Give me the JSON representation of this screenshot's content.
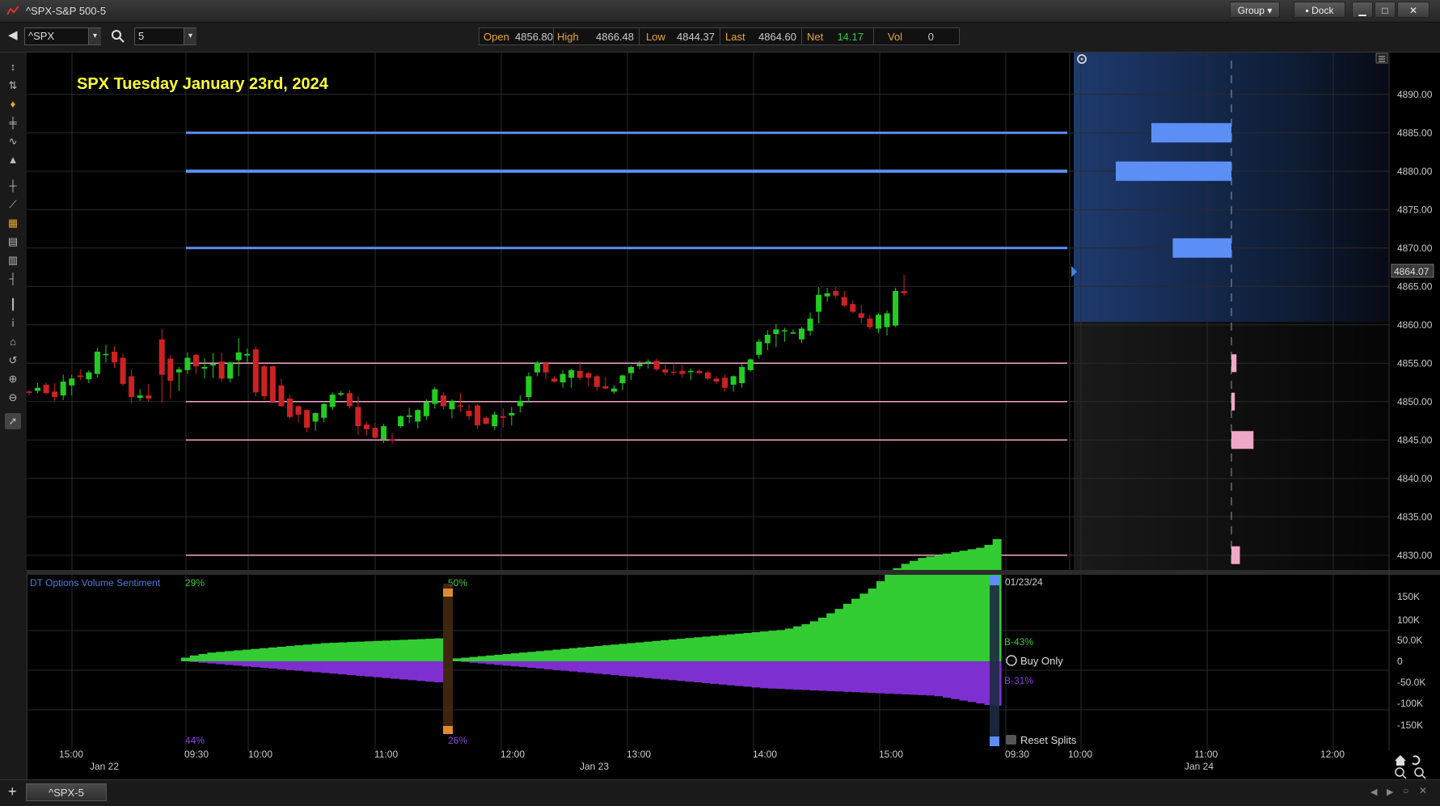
{
  "window": {
    "title": "^SPX-S&P 500-5",
    "group_label": "Group",
    "dock_label": "Dock"
  },
  "toolbar": {
    "symbol": "^SPX",
    "interval": "5"
  },
  "quote": {
    "open_label": "Open",
    "open": "4856.80",
    "high_label": "High",
    "high": "4866.48",
    "low_label": "Low",
    "low": "4844.37",
    "last_label": "Last",
    "last": "4864.60",
    "net_label": "Net",
    "net": "14.17",
    "vol_label": "Vol",
    "vol": "0"
  },
  "chart_title": "SPX Tuesday January 23rd, 2024",
  "colors": {
    "title": "#ffff33",
    "up": "#22cc22",
    "down": "#cc2222",
    "resistance": "#5b8ff5",
    "support": "#f0a8c8",
    "bull_vol": "#33cc33",
    "bear_vol": "#7e2fd0"
  },
  "price_axis": {
    "ticks": [
      "4890.00",
      "4885.00",
      "4880.00",
      "4875.00",
      "4870.00",
      "4865.00",
      "4860.00",
      "4855.00",
      "4850.00",
      "4845.00",
      "4840.00",
      "4835.00",
      "4830.00"
    ],
    "current": "4864.07"
  },
  "time_axis": {
    "times": [
      "15:00",
      "09:30",
      "10:00",
      "11:00",
      "12:00",
      "13:00",
      "14:00",
      "15:00",
      "09:30",
      "10:00",
      "11:00",
      "12:00"
    ],
    "dates": [
      "Jan 22",
      "Jan 23",
      "Jan 24"
    ]
  },
  "levels": {
    "resistance": [
      4885,
      4880,
      4870
    ],
    "support": [
      4855,
      4850,
      4845,
      4830
    ]
  },
  "profile": {
    "blue_bars": [
      {
        "price": 4885,
        "size": 0.45
      },
      {
        "price": 4880,
        "size": 0.65
      },
      {
        "price": 4870,
        "size": 0.33
      }
    ],
    "pink_bars": [
      {
        "price": 4855,
        "size": 0.03
      },
      {
        "price": 4850,
        "size": 0.02
      },
      {
        "price": 4845,
        "size": 0.13
      },
      {
        "price": 4830,
        "size": 0.05
      }
    ]
  },
  "chart_data": {
    "type": "candlestick",
    "title": "SPX Tuesday January 23rd, 2024",
    "ylim": [
      4826,
      4892
    ],
    "candles": [
      [
        4851.3,
        4851.5,
        4850.8,
        4851.2
      ],
      [
        4851.4,
        4852.4,
        4851.1,
        4851.8
      ],
      [
        4852.2,
        4852.5,
        4850.9,
        4851.1
      ],
      [
        4851.3,
        4852.4,
        4850.1,
        4850.6
      ],
      [
        4850.8,
        4853.5,
        4850.2,
        4852.6
      ],
      [
        4852.1,
        4853.5,
        4850.8,
        4853.0
      ],
      [
        4853.4,
        4854.2,
        4852.8,
        4853.2
      ],
      [
        4852.9,
        4854.1,
        4852.4,
        4853.8
      ],
      [
        4853.6,
        4857.0,
        4853.1,
        4856.5
      ],
      [
        4856.1,
        4857.4,
        4855.1,
        4856.2
      ],
      [
        4856.5,
        4857.2,
        4854.4,
        4855.1
      ],
      [
        4855.7,
        4856.2,
        4852.0,
        4852.3
      ],
      [
        4853.3,
        4854.2,
        4849.8,
        4850.6
      ],
      [
        4850.5,
        4851.6,
        4850.1,
        4850.8
      ],
      [
        4850.8,
        4852.3,
        4850.0,
        4850.4
      ],
      [
        4858.1,
        4859.5,
        4849.8,
        4853.5
      ],
      [
        4855.6,
        4856.1,
        4850.4,
        4852.7
      ],
      [
        4853.8,
        4854.5,
        4851.4,
        4854.2
      ],
      [
        4854.1,
        4856.4,
        4853.6,
        4855.7
      ],
      [
        4856.1,
        4856.2,
        4853.6,
        4854.6
      ],
      [
        4854.3,
        4855.6,
        4853.0,
        4854.5
      ],
      [
        4854.7,
        4856.3,
        4853.1,
        4854.9
      ],
      [
        4855.2,
        4856.4,
        4852.6,
        4853.0
      ],
      [
        4853.0,
        4855.2,
        4852.5,
        4855.1
      ],
      [
        4855.4,
        4858.3,
        4853.3,
        4856.4
      ],
      [
        4856.0,
        4856.9,
        4855.1,
        4856.2
      ],
      [
        4856.8,
        4857.2,
        4850.7,
        4851.2
      ],
      [
        4854.6,
        4854.8,
        4850.2,
        4850.7
      ],
      [
        4854.6,
        4854.7,
        4849.8,
        4850.0
      ],
      [
        4852.1,
        4853.0,
        4849.3,
        4849.4
      ],
      [
        4850.4,
        4850.9,
        4847.8,
        4848.0
      ],
      [
        4849.4,
        4849.5,
        4847.3,
        4848.3
      ],
      [
        4848.9,
        4849.0,
        4846.0,
        4846.6
      ],
      [
        4847.4,
        4848.6,
        4846.2,
        4848.5
      ],
      [
        4847.9,
        4849.8,
        4847.3,
        4849.7
      ],
      [
        4849.3,
        4851.2,
        4848.9,
        4850.9
      ],
      [
        4850.9,
        4851.4,
        4850.7,
        4851.1
      ],
      [
        4851.1,
        4851.5,
        4849.1,
        4849.4
      ],
      [
        4849.3,
        4850.7,
        4845.7,
        4846.8
      ],
      [
        4847.0,
        4847.4,
        4845.6,
        4846.4
      ],
      [
        4846.6,
        4847.2,
        4845.2,
        4845.3
      ],
      [
        4845.1,
        4847.1,
        4844.6,
        4846.8
      ],
      [
        4845.1,
        4845.9,
        4844.5,
        4845.0
      ],
      [
        4846.8,
        4848.2,
        4846.6,
        4848.1
      ],
      [
        4848.0,
        4849.2,
        4847.2,
        4848.2
      ],
      [
        4847.4,
        4849.0,
        4846.5,
        4848.9
      ],
      [
        4848.1,
        4850.3,
        4847.6,
        4849.9
      ],
      [
        4849.7,
        4851.9,
        4849.1,
        4851.6
      ],
      [
        4850.8,
        4851.2,
        4849.0,
        4849.4
      ],
      [
        4849.0,
        4850.3,
        4847.8,
        4850.1
      ],
      [
        4849.5,
        4851.1,
        4848.7,
        4849.4
      ],
      [
        4848.8,
        4849.6,
        4847.6,
        4848.1
      ],
      [
        4849.5,
        4849.7,
        4846.4,
        4846.9
      ],
      [
        4847.9,
        4848.1,
        4847.0,
        4847.1
      ],
      [
        4846.8,
        4848.7,
        4846.3,
        4848.3
      ],
      [
        4848.1,
        4849.1,
        4846.6,
        4847.9
      ],
      [
        4848.2,
        4849.3,
        4846.9,
        4848.5
      ],
      [
        4849.4,
        4850.8,
        4848.6,
        4850.1
      ],
      [
        4850.6,
        4853.8,
        4849.9,
        4853.3
      ],
      [
        4853.8,
        4855.3,
        4853.3,
        4855.1
      ],
      [
        4855.0,
        4855.2,
        4852.9,
        4853.8
      ],
      [
        4853.0,
        4853.3,
        4852.5,
        4852.6
      ],
      [
        4852.5,
        4854.1,
        4851.8,
        4853.6
      ],
      [
        4853.1,
        4854.3,
        4851.8,
        4854.1
      ],
      [
        4854.0,
        4855.2,
        4852.8,
        4853.1
      ],
      [
        4853.7,
        4853.9,
        4852.0,
        4853.1
      ],
      [
        4853.3,
        4853.5,
        4851.4,
        4851.9
      ],
      [
        4852.0,
        4853.2,
        4851.6,
        4851.7
      ],
      [
        4851.3,
        4852.1,
        4851.0,
        4851.7
      ],
      [
        4852.4,
        4853.5,
        4851.5,
        4853.4
      ],
      [
        4853.7,
        4854.7,
        4852.8,
        4854.5
      ],
      [
        4854.6,
        4855.3,
        4854.2,
        4854.9
      ],
      [
        4855.0,
        4855.5,
        4854.3,
        4855.2
      ],
      [
        4855.3,
        4855.6,
        4854.0,
        4854.2
      ],
      [
        4854.2,
        4854.8,
        4853.4,
        4853.8
      ],
      [
        4853.9,
        4855.0,
        4853.4,
        4853.8
      ],
      [
        4854.0,
        4854.8,
        4853.1,
        4853.6
      ],
      [
        4853.9,
        4854.3,
        4852.8,
        4854.0
      ],
      [
        4854.0,
        4854.2,
        4853.6,
        4853.7
      ],
      [
        4853.8,
        4854.0,
        4852.8,
        4853.0
      ],
      [
        4853.0,
        4853.3,
        4852.3,
        4852.6
      ],
      [
        4853.1,
        4853.5,
        4851.3,
        4851.8
      ],
      [
        4852.2,
        4853.4,
        4851.3,
        4853.3
      ],
      [
        4852.4,
        4854.9,
        4851.8,
        4854.5
      ],
      [
        4854.1,
        4855.6,
        4853.9,
        4855.5
      ],
      [
        4856.1,
        4858.1,
        4855.6,
        4857.8
      ],
      [
        4857.6,
        4859.3,
        4856.7,
        4858.7
      ],
      [
        4858.8,
        4860.1,
        4857.1,
        4859.4
      ],
      [
        4859.2,
        4859.6,
        4857.8,
        4859.3
      ],
      [
        4859.0,
        4859.4,
        4858.8,
        4859.0
      ],
      [
        4858.1,
        4859.7,
        4857.6,
        4859.5
      ],
      [
        4859.2,
        4861.6,
        4858.6,
        4860.8
      ],
      [
        4861.7,
        4864.9,
        4860.2,
        4863.9
      ],
      [
        4863.7,
        4864.8,
        4863.0,
        4864.1
      ],
      [
        4864.4,
        4864.9,
        4863.4,
        4863.8
      ],
      [
        4863.6,
        4864.4,
        4862.3,
        4862.5
      ],
      [
        4862.7,
        4863.2,
        4861.5,
        4861.7
      ],
      [
        4861.5,
        4862.6,
        4860.2,
        4860.9
      ],
      [
        4860.8,
        4861.3,
        4859.4,
        4859.7
      ],
      [
        4859.5,
        4861.5,
        4858.9,
        4861.3
      ],
      [
        4859.7,
        4861.9,
        4858.6,
        4861.5
      ],
      [
        4859.9,
        4864.8,
        4859.7,
        4864.4
      ],
      [
        4864.4,
        4866.5,
        4863.7,
        4864.1
      ]
    ]
  },
  "sentiment": {
    "title": "DT Options Volume Sentiment",
    "pct_top_left": "29%",
    "pct_bottom_left": "44%",
    "pct_top_mid": "50%",
    "pct_bottom_mid": "26%",
    "date": "01/23/24",
    "bull_label": "B-43%",
    "bear_label": "B-31%",
    "buy_only_label": "Buy Only",
    "reset_label": "Reset Splits",
    "ticks": [
      "150K",
      "100K",
      "50.0K",
      "0",
      "-50.0K",
      "-100K",
      "-150K"
    ],
    "ylim": [
      -175000,
      175000
    ],
    "bull_day1": [
      5000,
      8000,
      10000,
      12000,
      13000,
      14000,
      15000,
      16000,
      17000,
      18000,
      19000,
      20000,
      21000,
      22000,
      23000,
      24000,
      25000,
      25500,
      26000,
      26500,
      27000,
      27500,
      28000,
      28500,
      29000,
      29500,
      30000,
      30500,
      31000,
      31500
    ],
    "bear_day1": [
      0,
      -1000,
      -2000,
      -3000,
      -4000,
      -5000,
      -6000,
      -7000,
      -8000,
      -9000,
      -10000,
      -11000,
      -12000,
      -13000,
      -14000,
      -15000,
      -16000,
      -17000,
      -18000,
      -19000,
      -20000,
      -21000,
      -22000,
      -23000,
      -24000,
      -25000,
      -26000,
      -27000,
      -28000,
      -29000
    ],
    "bull_day2": [
      4000,
      5000,
      6000,
      7000,
      8000,
      9000,
      10000,
      11000,
      12000,
      13000,
      14000,
      15000,
      16000,
      17000,
      18000,
      19000,
      20000,
      21000,
      22000,
      23000,
      24000,
      25000,
      26000,
      27000,
      28000,
      29000,
      30000,
      31000,
      32000,
      33000,
      34000,
      35000,
      36000,
      37000,
      38000,
      39000,
      40000,
      41000,
      42000,
      43000,
      45000,
      48000,
      51000,
      55000,
      60000,
      66000,
      72000,
      79000,
      86000,
      93000,
      100000,
      110000,
      120000,
      128000,
      134000,
      138000,
      142000,
      144000,
      146000,
      148000,
      150000,
      152000,
      154000,
      156000,
      160000,
      168000
    ],
    "bear_day2": [
      0,
      -1000,
      -2000,
      -3000,
      -4000,
      -5000,
      -6000,
      -7000,
      -8000,
      -9000,
      -10000,
      -11000,
      -12000,
      -13000,
      -14000,
      -15000,
      -16000,
      -17000,
      -18000,
      -19000,
      -20000,
      -21000,
      -22000,
      -23000,
      -24000,
      -25000,
      -26000,
      -27000,
      -28000,
      -29000,
      -30000,
      -31000,
      -32000,
      -33000,
      -34000,
      -35000,
      -36000,
      -37000,
      -37500,
      -38000,
      -38500,
      -39000,
      -39500,
      -40000,
      -40500,
      -41000,
      -41500,
      -42000,
      -42500,
      -43000,
      -43500,
      -44000,
      -44500,
      -45000,
      -45500,
      -46000,
      -46500,
      -47000,
      -48000,
      -50000,
      -52000,
      -54000,
      -56000,
      -58000,
      -60000,
      -61000
    ]
  }
}
